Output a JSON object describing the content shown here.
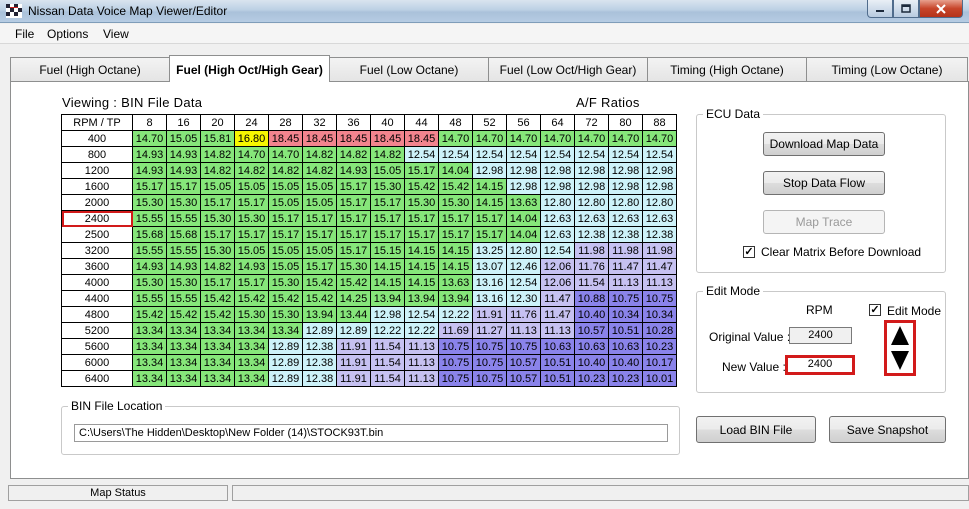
{
  "window": {
    "title": "Nissan Data Voice Map Viewer/Editor",
    "icon": "checkered-flag-icon"
  },
  "menu": [
    "File",
    "Options",
    "View"
  ],
  "tabs": [
    "Fuel (High Octane)",
    "Fuel (High Oct/High Gear)",
    "Fuel (Low Octane)",
    "Fuel (Low Oct/High Gear)",
    "Timing (High Octane)",
    "Timing (Low Octane)"
  ],
  "active_tab": 1,
  "viewing_label": "Viewing : BIN File Data",
  "ratios_label": "A/F Ratios",
  "grid": {
    "corner": "RPM / TP",
    "tp": [
      "8",
      "16",
      "20",
      "24",
      "28",
      "32",
      "36",
      "40",
      "44",
      "48",
      "52",
      "56",
      "64",
      "72",
      "80",
      "88"
    ],
    "rpm": [
      "400",
      "800",
      "1200",
      "1600",
      "2000",
      "2400",
      "2500",
      "3200",
      "3600",
      "4000",
      "4400",
      "4800",
      "5200",
      "5600",
      "6000",
      "6400"
    ],
    "selected_row": 5,
    "values": [
      [
        "14.70",
        "15.05",
        "15.81",
        "16.80",
        "18.45",
        "18.45",
        "18.45",
        "18.45",
        "18.45",
        "14.70",
        "14.70",
        "14.70",
        "14.70",
        "14.70",
        "14.70",
        "14.70"
      ],
      [
        "14.93",
        "14.93",
        "14.82",
        "14.70",
        "14.70",
        "14.82",
        "14.82",
        "14.82",
        "12.54",
        "12.54",
        "12.54",
        "12.54",
        "12.54",
        "12.54",
        "12.54",
        "12.54"
      ],
      [
        "14.93",
        "14.93",
        "14.82",
        "14.82",
        "14.82",
        "14.82",
        "14.93",
        "15.05",
        "15.17",
        "14.04",
        "12.98",
        "12.98",
        "12.98",
        "12.98",
        "12.98",
        "12.98"
      ],
      [
        "15.17",
        "15.17",
        "15.05",
        "15.05",
        "15.05",
        "15.05",
        "15.17",
        "15.30",
        "15.42",
        "15.42",
        "14.15",
        "12.98",
        "12.98",
        "12.98",
        "12.98",
        "12.98"
      ],
      [
        "15.30",
        "15.30",
        "15.17",
        "15.17",
        "15.05",
        "15.05",
        "15.17",
        "15.17",
        "15.30",
        "15.30",
        "14.15",
        "13.63",
        "12.80",
        "12.80",
        "12.80",
        "12.80"
      ],
      [
        "15.55",
        "15.55",
        "15.30",
        "15.30",
        "15.17",
        "15.17",
        "15.17",
        "15.17",
        "15.17",
        "15.17",
        "15.17",
        "14.04",
        "12.63",
        "12.63",
        "12.63",
        "12.63"
      ],
      [
        "15.68",
        "15.68",
        "15.17",
        "15.17",
        "15.17",
        "15.17",
        "15.17",
        "15.17",
        "15.17",
        "15.17",
        "15.17",
        "14.04",
        "12.63",
        "12.38",
        "12.38",
        "12.38"
      ],
      [
        "15.55",
        "15.55",
        "15.30",
        "15.05",
        "15.05",
        "15.05",
        "15.17",
        "15.15",
        "14.15",
        "14.15",
        "13.25",
        "12.80",
        "12.54",
        "11.98",
        "11.98",
        "11.98"
      ],
      [
        "14.93",
        "14.93",
        "14.82",
        "14.93",
        "15.05",
        "15.17",
        "15.30",
        "14.15",
        "14.15",
        "14.15",
        "13.07",
        "12.46",
        "12.06",
        "11.76",
        "11.47",
        "11.47"
      ],
      [
        "15.30",
        "15.30",
        "15.17",
        "15.17",
        "15.30",
        "15.42",
        "15.42",
        "14.15",
        "14.15",
        "13.63",
        "13.16",
        "12.54",
        "12.06",
        "11.54",
        "11.13",
        "11.13"
      ],
      [
        "15.55",
        "15.55",
        "15.42",
        "15.42",
        "15.42",
        "15.42",
        "14.25",
        "13.94",
        "13.94",
        "13.94",
        "13.16",
        "12.30",
        "11.47",
        "10.88",
        "10.75",
        "10.75"
      ],
      [
        "15.42",
        "15.42",
        "15.42",
        "15.30",
        "15.30",
        "13.94",
        "13.44",
        "12.98",
        "12.54",
        "12.22",
        "11.91",
        "11.76",
        "11.47",
        "10.40",
        "10.34",
        "10.34"
      ],
      [
        "13.34",
        "13.34",
        "13.34",
        "13.34",
        "13.34",
        "12.89",
        "12.89",
        "12.22",
        "12.22",
        "11.69",
        "11.27",
        "11.13",
        "11.13",
        "10.57",
        "10.51",
        "10.28"
      ],
      [
        "13.34",
        "13.34",
        "13.34",
        "13.34",
        "12.89",
        "12.38",
        "11.91",
        "11.54",
        "11.13",
        "10.75",
        "10.75",
        "10.75",
        "10.63",
        "10.63",
        "10.63",
        "10.23"
      ],
      [
        "13.34",
        "13.34",
        "13.34",
        "13.34",
        "12.89",
        "12.38",
        "11.91",
        "11.54",
        "11.13",
        "10.75",
        "10.75",
        "10.57",
        "10.51",
        "10.40",
        "10.40",
        "10.17"
      ],
      [
        "13.34",
        "13.34",
        "13.34",
        "13.34",
        "12.89",
        "12.38",
        "11.91",
        "11.54",
        "11.13",
        "10.75",
        "10.75",
        "10.57",
        "10.51",
        "10.23",
        "10.23",
        "10.01"
      ]
    ]
  },
  "colors": {
    "red": "#f2848e",
    "yellow": "#f7f700",
    "green": "#86e67a",
    "light_cyan": "#cdf2f9",
    "lavender": "#c6c1f1",
    "purple": "#8a83ea",
    "highlight": "#d21a1a"
  },
  "ecu": {
    "title": "ECU Data",
    "download_label": "Download Map Data",
    "stop_label": "Stop Data Flow",
    "trace_label": "Map Trace",
    "clear_label": "Clear Matrix Before Download",
    "clear_checked": true
  },
  "edit": {
    "title": "Edit Mode",
    "rpm_label": "RPM",
    "edit_mode_label": "Edit Mode",
    "edit_mode_checked": true,
    "original_label": "Original Value :",
    "original_value": "2400",
    "new_label": "New Value :",
    "new_value": "2400",
    "stepper_icons": [
      "triangle-up-icon",
      "triangle-down-icon"
    ]
  },
  "bin": {
    "title": "BIN File Location",
    "path": "C:\\Users\\The Hidden\\Desktop\\New Folder (14)\\STOCK93T.bin",
    "load_label": "Load BIN File",
    "snapshot_label": "Save Snapshot"
  },
  "status": {
    "map_status": "Map Status"
  }
}
